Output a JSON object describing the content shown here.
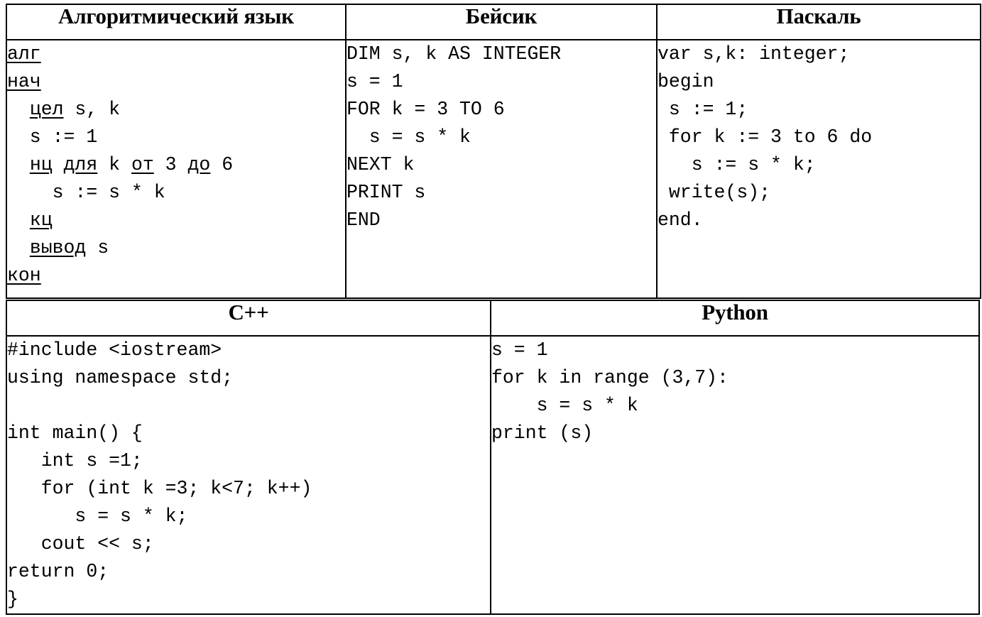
{
  "document": {
    "kind": "programming-languages-comparison-table",
    "description": "Same factorial-style loop program written in five notations"
  },
  "table_top": {
    "columns": [
      {
        "id": "algorithmic",
        "header": "Алгоритмический язык",
        "code_lines": [
          [
            {
              "t": "алг",
              "u": true
            }
          ],
          [
            {
              "t": "нач",
              "u": true
            }
          ],
          [
            {
              "t": "  ",
              "u": false
            },
            {
              "t": "цел",
              "u": true
            },
            {
              "t": " s, k",
              "u": false
            }
          ],
          [
            {
              "t": "  s := 1",
              "u": false
            }
          ],
          [
            {
              "t": "  ",
              "u": false
            },
            {
              "t": "нц",
              "u": true
            },
            {
              "t": " ",
              "u": false
            },
            {
              "t": "для",
              "u": true
            },
            {
              "t": " k ",
              "u": false
            },
            {
              "t": "от",
              "u": true
            },
            {
              "t": " 3 ",
              "u": false
            },
            {
              "t": "до",
              "u": true
            },
            {
              "t": " 6",
              "u": false
            }
          ],
          [
            {
              "t": "    s := s * k",
              "u": false
            }
          ],
          [
            {
              "t": "  ",
              "u": false
            },
            {
              "t": "кц",
              "u": true
            }
          ],
          [
            {
              "t": "  ",
              "u": false
            },
            {
              "t": "вывод",
              "u": true
            },
            {
              "t": " s",
              "u": false
            }
          ],
          [
            {
              "t": "кон",
              "u": true
            }
          ]
        ],
        "code_plain": "алг\nнач\n  цел s, k\n  s := 1\n  нц для k от 3 до 6\n    s := s * k\n  кц\n  вывод s\nкон"
      },
      {
        "id": "basic",
        "header": "Бейсик",
        "code_lines": [
          [
            {
              "t": "DIM s, k AS INTEGER",
              "u": false
            }
          ],
          [
            {
              "t": "s = 1",
              "u": false
            }
          ],
          [
            {
              "t": "FOR k = 3 TO 6",
              "u": false
            }
          ],
          [
            {
              "t": "  s = s * k",
              "u": false
            }
          ],
          [
            {
              "t": "NEXT k",
              "u": false
            }
          ],
          [
            {
              "t": "PRINT s",
              "u": false
            }
          ],
          [
            {
              "t": "END",
              "u": false
            }
          ]
        ],
        "code_plain": "DIM s, k AS INTEGER\ns = 1\nFOR k = 3 TO 6\n  s = s * k\nNEXT k\nPRINT s\nEND"
      },
      {
        "id": "pascal",
        "header": "Паскаль",
        "code_lines": [
          [
            {
              "t": "var s,k: integer;",
              "u": false
            }
          ],
          [
            {
              "t": "begin",
              "u": false
            }
          ],
          [
            {
              "t": " s := 1;",
              "u": false
            }
          ],
          [
            {
              "t": " for k := 3 to 6 do",
              "u": false
            }
          ],
          [
            {
              "t": "   s := s * k;",
              "u": false
            }
          ],
          [
            {
              "t": " write(s);",
              "u": false
            }
          ],
          [
            {
              "t": "end.",
              "u": false
            }
          ]
        ],
        "code_plain": "var s,k: integer;\nbegin\n s := 1;\n for k := 3 to 6 do\n   s := s * k;\n write(s);\nend."
      }
    ]
  },
  "table_bottom": {
    "columns": [
      {
        "id": "cpp",
        "header": "C++",
        "code_lines": [
          [
            {
              "t": "#include <iostream>",
              "u": false
            }
          ],
          [
            {
              "t": "using namespace std;",
              "u": false
            }
          ],
          [
            {
              "t": "",
              "u": false
            }
          ],
          [
            {
              "t": "int main() {",
              "u": false
            }
          ],
          [
            {
              "t": "   int s =1;",
              "u": false
            }
          ],
          [
            {
              "t": "   for (int k =3; k<7; k++)",
              "u": false
            }
          ],
          [
            {
              "t": "      s = s * k;",
              "u": false
            }
          ],
          [
            {
              "t": "   cout << s;",
              "u": false
            }
          ],
          [
            {
              "t": "return 0;",
              "u": false
            }
          ],
          [
            {
              "t": "}",
              "u": false
            }
          ]
        ],
        "code_plain": "#include <iostream>\nusing namespace std;\n\nint main() {\n   int s =1;\n   for (int k =3; k<7; k++)\n      s = s * k;\n   cout << s;\nreturn 0;\n}"
      },
      {
        "id": "python",
        "header": "Python",
        "code_lines": [
          [
            {
              "t": "s = 1",
              "u": false
            }
          ],
          [
            {
              "t": "for k in range (3,7):",
              "u": false
            }
          ],
          [
            {
              "t": "    s = s * k",
              "u": false
            }
          ],
          [
            {
              "t": "print (s)",
              "u": false
            }
          ]
        ],
        "code_plain": "s = 1\nfor k in range (3,7):\n    s = s * k\nprint (s)"
      }
    ]
  },
  "colors": {
    "border": "#000000",
    "text": "#000000",
    "background": "#ffffff"
  }
}
